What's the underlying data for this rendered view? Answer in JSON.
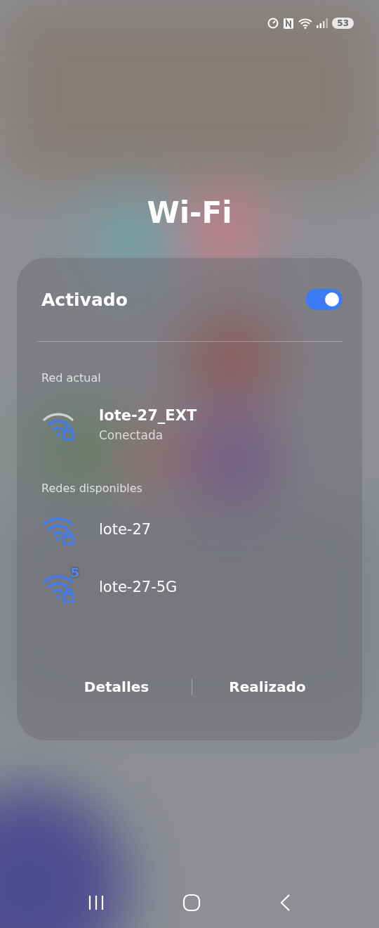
{
  "status_bar": {
    "battery": "53"
  },
  "title": "Wi-Fi",
  "panel": {
    "toggle": {
      "label": "Activado",
      "on": true
    },
    "current": {
      "heading": "Red actual",
      "networks": [
        {
          "name": "lote-27_EXT",
          "status": "Conectada",
          "secured": true
        }
      ]
    },
    "available": {
      "heading": "Redes disponibles",
      "networks": [
        {
          "name": "lote-27",
          "secured": true
        },
        {
          "name": "lote-27-5G",
          "secured": true,
          "band": "5"
        }
      ]
    },
    "buttons": [
      "Detalles",
      "Realizado"
    ]
  }
}
